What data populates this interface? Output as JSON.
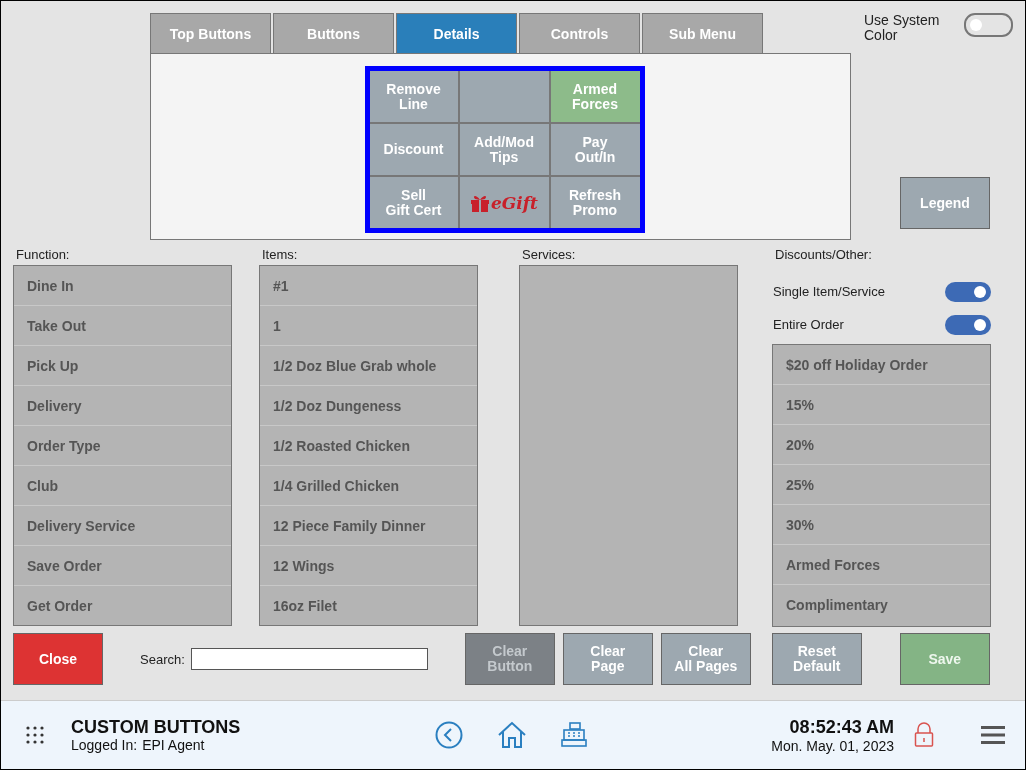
{
  "tabs": [
    {
      "label": "Top Buttons",
      "selected": false
    },
    {
      "label": "Buttons",
      "selected": false
    },
    {
      "label": "Details",
      "selected": true
    },
    {
      "label": "Controls",
      "selected": false
    },
    {
      "label": "Sub Menu",
      "selected": false
    }
  ],
  "system_color": {
    "label": "Use System Color",
    "on": false
  },
  "button_grid": [
    {
      "kind": "text",
      "label": "Remove\nLine",
      "color": "#9da8b0"
    },
    {
      "kind": "empty",
      "color": "#9da8b0"
    },
    {
      "kind": "text",
      "label": "Armed\nForces",
      "color": "#8dbb8a"
    },
    {
      "kind": "text",
      "label": "Discount",
      "color": "#9da8b0"
    },
    {
      "kind": "text",
      "label": "Add/Mod\nTips",
      "color": "#9da8b0"
    },
    {
      "kind": "text",
      "label": "Pay\nOut/In",
      "color": "#9da8b0"
    },
    {
      "kind": "text",
      "label": "Sell\nGift Cert",
      "color": "#9da8b0"
    },
    {
      "kind": "logo",
      "label": "eGift",
      "color": "#9da8b0"
    },
    {
      "kind": "text",
      "label": "Refresh\nPromo",
      "color": "#9da8b0"
    }
  ],
  "legend_button": "Legend",
  "function": {
    "label": "Function:",
    "items": [
      "Dine In",
      "Take Out",
      "Pick Up",
      "Delivery",
      "Order Type",
      "Club",
      "Delivery Service",
      "Save Order",
      "Get Order"
    ]
  },
  "items": {
    "label": "Items:",
    "items": [
      "#1",
      "1",
      "1/2 Doz Blue Grab whole",
      "1/2 Doz Dungeness",
      "1/2 Roasted Chicken",
      "1/4 Grilled Chicken",
      "12 Piece Family Dinner",
      "12 Wings",
      "16oz Filet"
    ]
  },
  "services": {
    "label": "Services:"
  },
  "discounts": {
    "label": "Discounts/Other:",
    "toggles": [
      {
        "label": "Single Item/Service",
        "on": true
      },
      {
        "label": "Entire Order",
        "on": true
      }
    ],
    "items": [
      "$20 off Holiday Order",
      "15%",
      "20%",
      "25%",
      "30%",
      "Armed Forces",
      "Complimentary"
    ]
  },
  "close_button": "Close",
  "search": {
    "label": "Search:"
  },
  "actions": [
    {
      "label": "Clear\nButton",
      "disabled": true
    },
    {
      "label": "Clear\nPage",
      "disabled": false
    },
    {
      "label": "Clear\nAll Pages",
      "disabled": false
    },
    {
      "label": "Reset\nDefault",
      "disabled": false
    }
  ],
  "save_button": {
    "label": "Save",
    "disabled": true
  },
  "footer": {
    "title": "CUSTOM BUTTONS",
    "user_label": "Logged In:",
    "user": "EPI Agent",
    "time": "08:52:43 AM",
    "date": "Mon. May. 01, 2023"
  }
}
